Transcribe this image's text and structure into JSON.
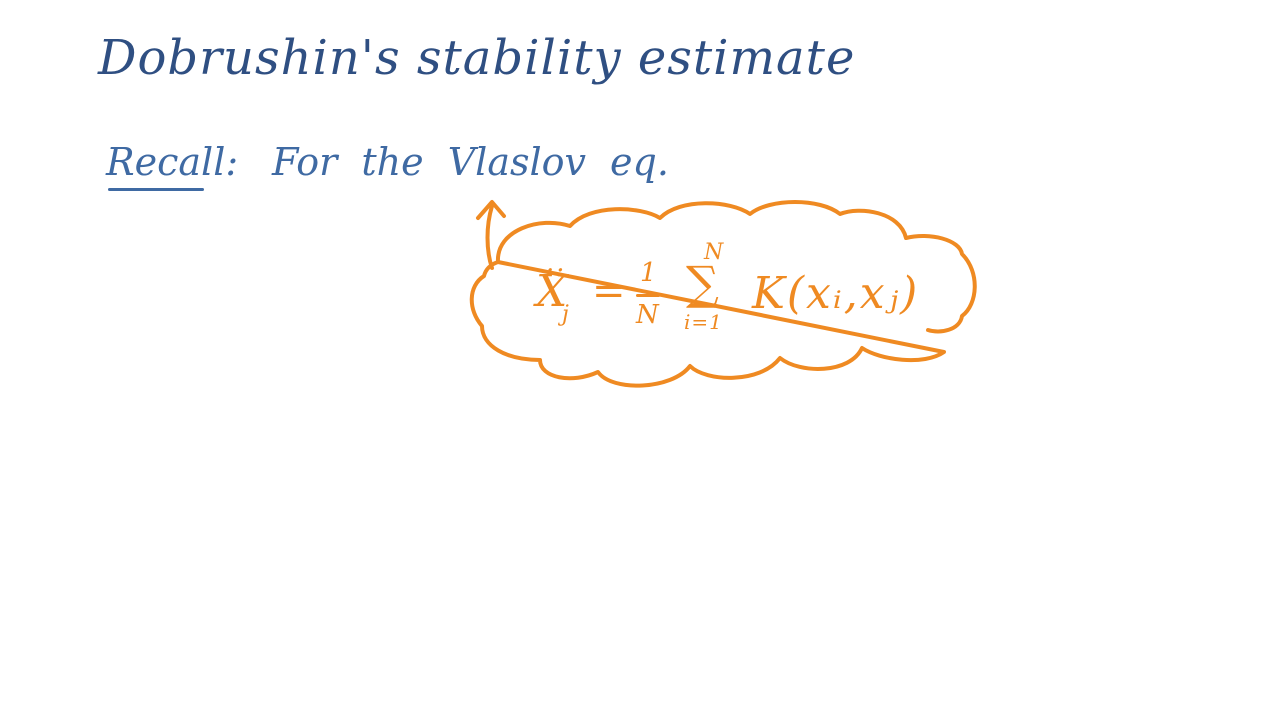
{
  "title": "Dobrushin's stability estimate",
  "recall": {
    "label": "Recall:",
    "text": "For the Vlaslov eq."
  },
  "formula": {
    "lhs": "X",
    "lhs_dots": "..",
    "lhs_sub": "j",
    "eq": "=",
    "frac_num": "1",
    "frac_den": "N",
    "sum_upper": "N",
    "sum_symbol": "∑",
    "sum_lower": "i=1",
    "rhs": "K(xᵢ,xⱼ)"
  },
  "colors": {
    "title": "#2f4f82",
    "recall": "#3f6aa3",
    "accent": "#ef8a22"
  }
}
